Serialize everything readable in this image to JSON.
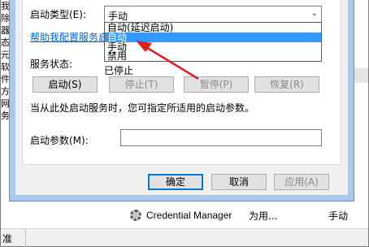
{
  "background": {
    "left_chars": [
      "我",
      "除",
      "器",
      "态",
      "元",
      "软",
      "件",
      "方",
      "网",
      "务"
    ],
    "service_row": {
      "name": "Credential Manager",
      "description": "为用...",
      "startup": "手动"
    },
    "status_tab": "准"
  },
  "dialog": {
    "startup_type_label": "启动类型(E):",
    "startup_type_value": "手动",
    "help_link": "帮助我配置服务启",
    "dropdown_options": [
      "自动(延迟启动)",
      "自动",
      "手动",
      "禁用"
    ],
    "dropdown_selected": "自动",
    "service_status_label": "服务状态:",
    "service_status_value": "已停止",
    "buttons": {
      "start": "启动(S)",
      "stop": "停止(T)",
      "pause": "暂停(P)",
      "resume": "恢复(R)"
    },
    "hint": "当从此处启动服务时，您可指定所适用的启动参数。",
    "start_params_label": "启动参数(M):",
    "start_params_value": "",
    "footer": {
      "ok": "确定",
      "cancel": "取消",
      "apply": "应用(A)"
    }
  },
  "colors": {
    "selection": "#3399ff",
    "link": "#0066cc",
    "annotation_arrow": "#e02020",
    "dialog_frame": "#a9cbe9"
  }
}
